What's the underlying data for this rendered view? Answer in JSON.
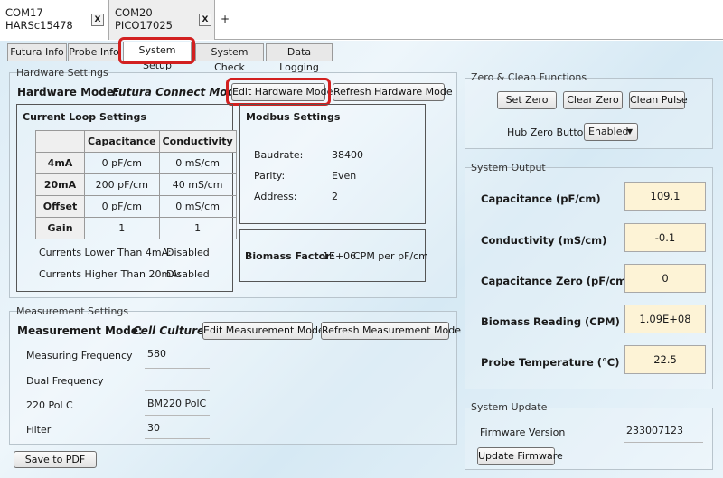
{
  "com_tabs": [
    {
      "line1": "COM17",
      "line2": "HARSc15478",
      "close": "X"
    },
    {
      "line1": "COM20",
      "line2": "PICO17025",
      "close": "X"
    }
  ],
  "add_tab": "+",
  "sub_tabs": [
    "Futura Info",
    "Probe Info",
    "System Setup",
    "System Check",
    "Data Logging"
  ],
  "hardware": {
    "group_label": "Hardware Settings",
    "mode_label": "Hardware Mode:",
    "mode_value": "Futura Connect Mode",
    "edit_button": "Edit Hardware Mode",
    "refresh_button": "Refresh Hardware Mode"
  },
  "current_loop": {
    "title": "Current Loop Settings",
    "headers": [
      "",
      "Capacitance",
      "Conductivity"
    ],
    "rows": [
      {
        "label": "4mA",
        "cap": "0 pF/cm",
        "cond": "0 mS/cm"
      },
      {
        "label": "20mA",
        "cap": "200 pF/cm",
        "cond": "40 mS/cm"
      },
      {
        "label": "Offset",
        "cap": "0 pF/cm",
        "cond": "0 mS/cm"
      },
      {
        "label": "Gain",
        "cap": "1",
        "cond": "1"
      }
    ],
    "lower_label": "Currents Lower Than 4mA:",
    "lower_value": "Disabled",
    "higher_label": "Currents Higher Than 20mA:",
    "higher_value": "Disabled"
  },
  "modbus": {
    "title": "Modbus Settings",
    "baudrate_label": "Baudrate:",
    "baudrate": "38400",
    "parity_label": "Parity:",
    "parity": "Even",
    "address_label": "Address:",
    "address": "2"
  },
  "biomass": {
    "label": "Biomass Factor:",
    "value": "1E+06",
    "unit": "CPM per pF/cm"
  },
  "measurement": {
    "group_label": "Measurement Settings",
    "mode_label": "Measurement Mode:",
    "mode_value": "Cell Culture",
    "edit_button": "Edit Measurement Mode",
    "refresh_button": "Refresh Measurement Mode",
    "fields": [
      {
        "label": "Measuring Frequency",
        "value": "580"
      },
      {
        "label": "Dual Frequency",
        "value": ""
      },
      {
        "label": "220 Pol C",
        "value": "BM220 PolC"
      },
      {
        "label": "Filter",
        "value": "30"
      }
    ]
  },
  "save_pdf": "Save to PDF",
  "zero_clean": {
    "group_label": "Zero & Clean Functions",
    "set_zero": "Set Zero",
    "clear_zero": "Clear Zero",
    "clean_pulse": "Clean Pulse",
    "hub_label": "Hub Zero Button",
    "hub_value": "Enabled"
  },
  "system_output": {
    "group_label": "System Output",
    "items": [
      {
        "label": "Capacitance (pF/cm)",
        "value": "109.1"
      },
      {
        "label": "Conductivity (mS/cm)",
        "value": "-0.1"
      },
      {
        "label": "Capacitance Zero (pF/cm)",
        "value": "0"
      },
      {
        "label": "Biomass Reading (CPM)",
        "value": "1.09E+08"
      },
      {
        "label": "Probe Temperature (°C)",
        "value": "22.5"
      }
    ]
  },
  "system_update": {
    "group_label": "System Update",
    "firmware_label": "Firmware Version",
    "firmware_value": "233007123",
    "update_button": "Update Firmware"
  },
  "colors": {
    "highlight": "#d22020",
    "output_bg": "#fdf3d6"
  }
}
